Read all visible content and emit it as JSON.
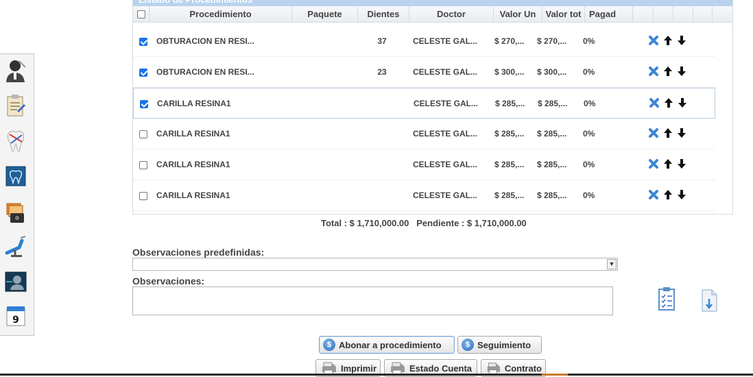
{
  "table": {
    "title": "Listado de Procedimientos",
    "headers": [
      "Procedimiento",
      "Paquete",
      "Dientes",
      "Doctor",
      "Valor Un",
      "Valor tot",
      "Pagad"
    ],
    "rows": [
      {
        "checked": true,
        "procedimiento": "OBTURACION EN RESI...",
        "paquete": "",
        "dientes": "37",
        "doctor": "CELESTE GAL...",
        "valor_un": "$ 270,...",
        "valor_tot": "$ 270,...",
        "pagado": "0%",
        "selected": false
      },
      {
        "checked": true,
        "procedimiento": "OBTURACION EN RESI...",
        "paquete": "",
        "dientes": "23",
        "doctor": "CELESTE GAL...",
        "valor_un": "$ 300,...",
        "valor_tot": "$ 300,...",
        "pagado": "0%",
        "selected": false
      },
      {
        "checked": true,
        "procedimiento": "CARILLA RESINA1",
        "paquete": "",
        "dientes": "",
        "doctor": "CELESTE GAL...",
        "valor_un": "$ 285,...",
        "valor_tot": "$ 285,...",
        "pagado": "0%",
        "selected": true
      },
      {
        "checked": false,
        "procedimiento": "CARILLA RESINA1",
        "paquete": "",
        "dientes": "",
        "doctor": "CELESTE GAL...",
        "valor_un": "$ 285,...",
        "valor_tot": "$ 285,...",
        "pagado": "0%",
        "selected": false
      },
      {
        "checked": false,
        "procedimiento": "CARILLA RESINA1",
        "paquete": "",
        "dientes": "",
        "doctor": "CELESTE GAL...",
        "valor_un": "$ 285,...",
        "valor_tot": "$ 285,...",
        "pagado": "0%",
        "selected": false
      },
      {
        "checked": false,
        "procedimiento": "CARILLA RESINA1",
        "paquete": "",
        "dientes": "",
        "doctor": "CELESTE GAL...",
        "valor_un": "$ 285,...",
        "valor_tot": "$ 285,...",
        "pagado": "0%",
        "selected": false
      }
    ]
  },
  "totals": {
    "text": "Total : $ 1,710,000.00   Pendiente : $ 1,710,000.00"
  },
  "form": {
    "observaciones_predefinidas_label": "Observaciones predefinidas:",
    "observaciones_predefinidas_value": "",
    "observaciones_label": "Observaciones:",
    "observaciones_value": ""
  },
  "buttons": {
    "abonar": "Abonar a procedimiento",
    "seguimiento": "Seguimiento",
    "imprimir": "Imprimir",
    "estado_cuenta": "Estado Cuenta",
    "contrato": "Contrato"
  },
  "toolbar": [
    "doctor-icon",
    "notes-icon",
    "tooth-icon",
    "dental-chart-icon",
    "photo-camera-icon",
    "dental-chair-icon",
    "xray-icon",
    "calendar-icon"
  ],
  "colors": {
    "panel_title_bg": "#b9d3ee",
    "checkbox_checked": "#1a73e8",
    "delete_icon": "#3d86d4",
    "coin_blue": "#2f6fb8"
  }
}
